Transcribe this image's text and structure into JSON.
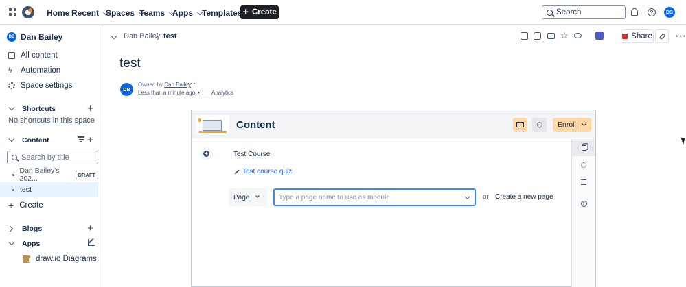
{
  "topnav": {
    "items": [
      {
        "label": "Home",
        "dropdown": false
      },
      {
        "label": "Recent",
        "dropdown": true
      },
      {
        "label": "Spaces",
        "dropdown": true
      },
      {
        "label": "Teams",
        "dropdown": true
      },
      {
        "label": "Apps",
        "dropdown": true
      },
      {
        "label": "Templates",
        "dropdown": false
      }
    ],
    "create_label": "Create",
    "search_label": "Search",
    "user_initials": "DB"
  },
  "sidebar": {
    "space_name": "Dan Bailey",
    "space_initials": "DB",
    "nav": [
      "All content",
      "Automation",
      "Space settings"
    ],
    "shortcuts_label": "Shortcuts",
    "shortcuts_empty": "No shortcuts in this space",
    "content_label": "Content",
    "search_placeholder": "Search by title",
    "tree": [
      {
        "title": "Dan Bailey's 202...",
        "badge": "DRAFT"
      },
      {
        "title": "test",
        "badge": ""
      }
    ],
    "create_label": "Create",
    "blogs_label": "Blogs",
    "apps_label": "Apps",
    "app_item": "draw.io Diagrams"
  },
  "header": {
    "breadcrumb_space": "Dan Bailey",
    "breadcrumb_sep": "/",
    "breadcrumb_page": "test",
    "share_label": "Share"
  },
  "page": {
    "title": "test",
    "owner_initials": "DB",
    "owned_prefix": "Owned by",
    "owner_name": "Dan Bailey",
    "updated": "Less than a minute ago",
    "dot": "•",
    "analytics_label": "Analytics"
  },
  "course": {
    "header_title": "Content",
    "enroll_label": "Enroll",
    "course_name": "Test Course",
    "quiz_label": "Test course quiz",
    "type_value": "Page",
    "page_placeholder": "Type a page name to use as module",
    "or_label": "or",
    "new_page_label": "Create a new page"
  }
}
